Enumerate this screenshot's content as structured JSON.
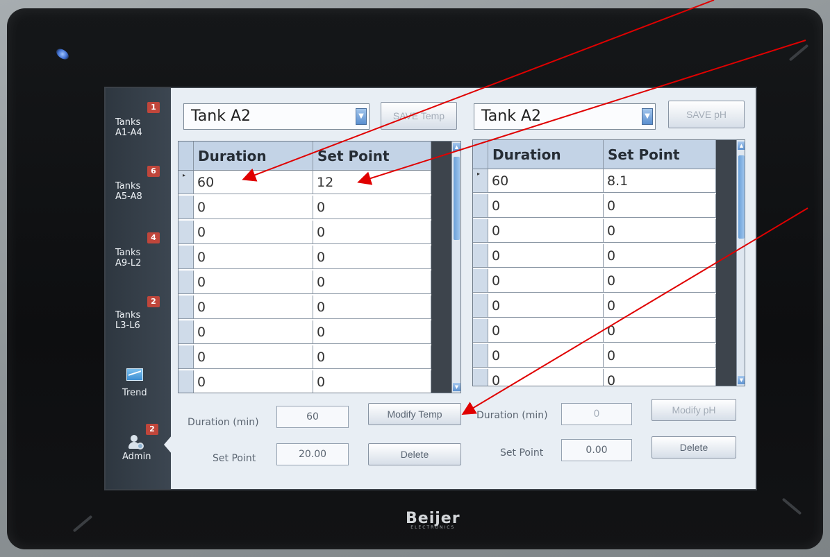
{
  "brand": {
    "name": "Beijer",
    "sub": "ELECTRONICS"
  },
  "sidebar": {
    "items": [
      {
        "label": "Tanks A1-A4",
        "badge": "1"
      },
      {
        "label": "Tanks A5-A8",
        "badge": "6"
      },
      {
        "label": "Tanks A9-L2",
        "badge": "4"
      },
      {
        "label": "Tanks L3-L6",
        "badge": "2"
      },
      {
        "label": "Trend",
        "icon": "trend-chart-icon"
      },
      {
        "label": "Admin",
        "badge": "2",
        "icon": "admin-user-icon"
      }
    ]
  },
  "temp_panel": {
    "tank_select": "Tank A2",
    "save_label": "SAVE Temp",
    "columns": [
      "Duration",
      "Set Point"
    ],
    "rows": [
      [
        "60",
        "12"
      ],
      [
        "0",
        "0"
      ],
      [
        "0",
        "0"
      ],
      [
        "0",
        "0"
      ],
      [
        "0",
        "0"
      ],
      [
        "0",
        "0"
      ],
      [
        "0",
        "0"
      ],
      [
        "0",
        "0"
      ],
      [
        "0",
        "0"
      ]
    ],
    "duration_label": "Duration (min)",
    "duration_value": "60",
    "setpoint_label": "Set Point",
    "setpoint_value": "20.00",
    "modify_label": "Modify Temp",
    "delete_label": "Delete"
  },
  "ph_panel": {
    "tank_select": "Tank A2",
    "save_label": "SAVE pH",
    "columns": [
      "Duration",
      "Set Point"
    ],
    "rows": [
      [
        "60",
        "8.1"
      ],
      [
        "0",
        "0"
      ],
      [
        "0",
        "0"
      ],
      [
        "0",
        "0"
      ],
      [
        "0",
        "0"
      ],
      [
        "0",
        "0"
      ],
      [
        "0",
        "0"
      ],
      [
        "0",
        "0"
      ],
      [
        "0",
        "0"
      ]
    ],
    "duration_label": "Duration (min)",
    "duration_value": "0",
    "setpoint_label": "Set Point",
    "setpoint_value": "0.00",
    "modify_label": "Modify pH",
    "delete_label": "Delete"
  },
  "colors": {
    "screen_bg": "#e8eef4",
    "sidebar_bg": "#2e3740",
    "badge": "#c0463b",
    "accent_blue": "#5b8fcf",
    "annotation_arrow": "#e00000"
  }
}
